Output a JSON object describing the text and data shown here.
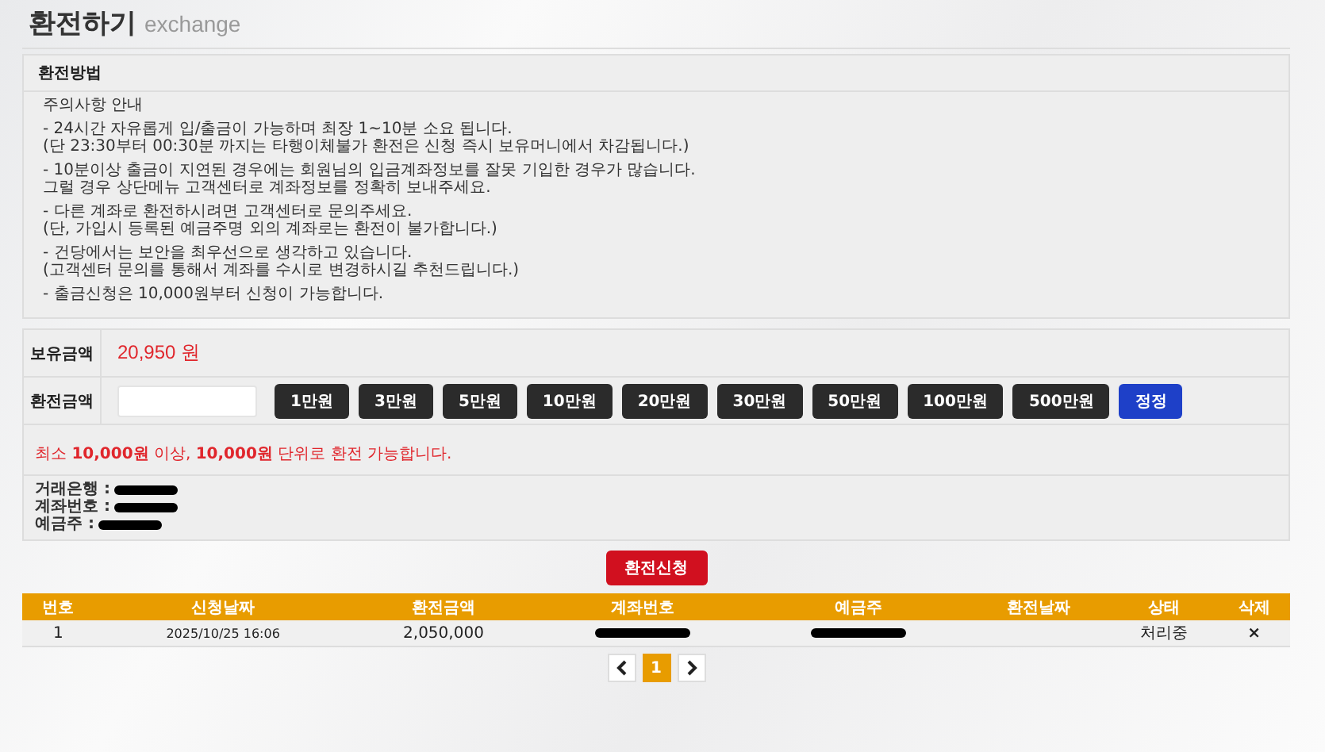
{
  "page_title": {
    "main": "환전하기",
    "sub": "exchange"
  },
  "guide": {
    "title": "환전방법",
    "intro": "주의사항 안내",
    "paragraphs": [
      {
        "lines": [
          "- 24시간 자유롭게 입/출금이 가능하며 최장 1~10분 소요 됩니다.",
          "(단 23:30부터 00:30분 까지는 타행이체불가 환전은 신청 즉시 보유머니에서 차감됩니다.)"
        ]
      },
      {
        "lines": [
          "- 10분이상 출금이 지연된 경우에는 회원님의 입금계좌정보를 잘못 기입한 경우가 많습니다.",
          "그럴 경우 상단메뉴 고객센터로 계좌정보를 정확히 보내주세요."
        ]
      },
      {
        "lines": [
          "- 다른 계좌로 환전하시려면 고객센터로 문의주세요.",
          "(단, 가입시 등록된 예금주명 외의 계좌로는 환전이 불가합니다.)"
        ]
      },
      {
        "lines": [
          "- 건당에서는 보안을 최우선으로 생각하고 있습니다.",
          "(고객센터 문의를 통해서 계좌를 수시로 변경하시길 추천드립니다.)"
        ]
      },
      {
        "lines": [
          "- 출금신청은 10,000원부터 신청이 가능합니다."
        ]
      }
    ]
  },
  "form": {
    "balance_label": "보유금액",
    "balance": "20,950 원",
    "amount_label": "환전금액",
    "buttons": [
      {
        "kind": "amount",
        "label": "1만원"
      },
      {
        "kind": "amount",
        "label": "3만원"
      },
      {
        "kind": "amount",
        "label": "5만원"
      },
      {
        "kind": "amount",
        "label": "10만원"
      },
      {
        "kind": "amount",
        "label": "20만원"
      },
      {
        "kind": "amount",
        "label": "30만원"
      },
      {
        "kind": "amount",
        "label": "50만원"
      },
      {
        "kind": "amount",
        "label": "100만원"
      },
      {
        "kind": "amount",
        "label": "500만원"
      },
      {
        "kind": "reset",
        "label": "정정"
      }
    ],
    "note": "최소 **10,000원** 이상, **10,000원**  단위로 환전 가능합니다.",
    "bank_info": [
      {
        "label": "거래은행 :"
      },
      {
        "label": "계좌번호 :"
      },
      {
        "label": "예금주 :"
      }
    ]
  },
  "submit_button": "환전신청",
  "table": {
    "columns": [
      "번호",
      "신청날짜",
      "환전금액",
      "계좌번호",
      "예금주",
      "환전날짜",
      "상태",
      "삭제"
    ],
    "rows": [
      {
        "cells": [
          {
            "kind": "text",
            "text": "1"
          },
          {
            "kind": "date",
            "text": "2025/10/25 16:06"
          },
          {
            "kind": "text",
            "text": "2,050,000"
          },
          {
            "kind": "redacted"
          },
          {
            "kind": "redacted"
          },
          {
            "kind": "empty"
          },
          {
            "kind": "text",
            "text": "처리중"
          },
          {
            "kind": "delete",
            "text": "×"
          }
        ]
      }
    ]
  },
  "pagination": {
    "pages": [
      {
        "label": "1",
        "selected": true
      }
    ]
  }
}
